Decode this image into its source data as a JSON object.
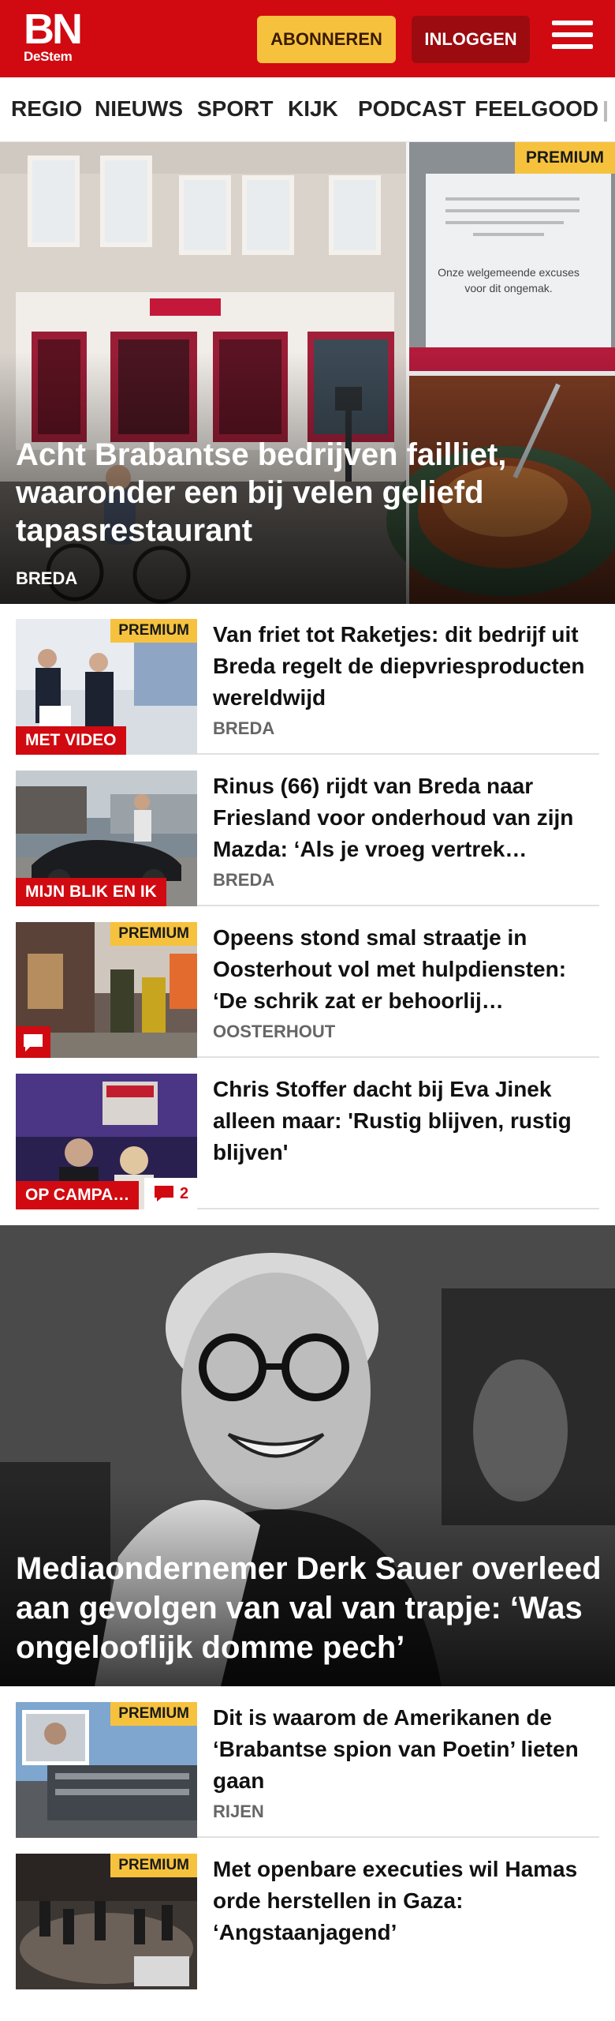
{
  "header": {
    "logo_main": "BN",
    "logo_sub": "DeStem",
    "subscribe_label": "ABONNEREN",
    "login_label": "INLOGGEN",
    "brand_color": "#d10a11",
    "accent_color": "#f6c23e"
  },
  "nav": {
    "items": [
      "REGIO",
      "NIEUWS",
      "SPORT",
      "KIJK",
      "PODCAST",
      "FEELGOOD"
    ]
  },
  "hero1": {
    "badge": "PREMIUM",
    "title": "Acht Brabantse bedrijven failliet, waaronder een bij velen geliefd tapasrestaurant",
    "location": "BREDA",
    "sign_text": "Onze welgemeende excuses voor dit ongemak."
  },
  "articles": [
    {
      "badge": "PREMIUM",
      "tag": "MET VIDEO",
      "title": "Van friet tot Raketjes: dit bedrijf uit Breda regelt de diepvriespro­ducten wereldwijd",
      "location": "BREDA"
    },
    {
      "badge": "",
      "tag": "MIJN BLIK EN IK",
      "title": "Rinus (66) rijdt van Breda naar Friesland voor onderhoud van zijn Mazda: ‘Als je vroeg vertrek…",
      "location": "BREDA"
    },
    {
      "badge": "PREMIUM",
      "tag": "",
      "title": "Opeens stond smal straatje in Oosterhout vol met hulpdien­sten: ‘De schrik zat er behoorlij…",
      "location": "OOSTERHOUT"
    },
    {
      "badge": "",
      "tag": "OP CAMPA…",
      "comments": "2",
      "title": "Chris Stoffer dacht bij Eva Jinek alleen maar: 'Rustig blijven, rustig blijven'",
      "location": ""
    }
  ],
  "hero2": {
    "title": "Mediaondernemer Derk Sauer overleed aan gevolgen van val van trapje: ‘Was ongelooflijk domme pech’"
  },
  "articles2": [
    {
      "badge": "PREMIUM",
      "title": "Dit is waarom de Amerikanen de ‘Brabantse spion van Poetin’ lieten gaan",
      "location": "RIJEN"
    },
    {
      "badge": "PREMIUM",
      "title": "Met openbare executies wil Hamas orde herstellen in Gaza: ‘Angstaanjagend’",
      "location": ""
    }
  ]
}
